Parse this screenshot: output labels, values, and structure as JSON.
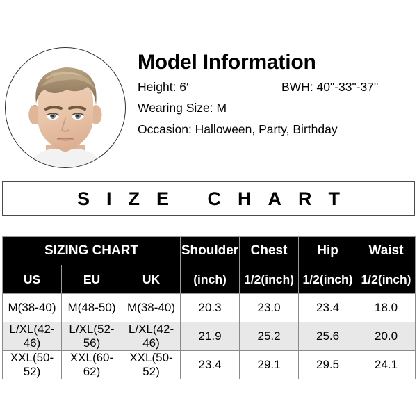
{
  "model": {
    "title": "Model Information",
    "avatar_alt": "model-portrait",
    "height_label": "Height: 6′",
    "bwh_label": "BWH: 40\"-33\"-37\"",
    "wearing_size_label": "Wearing Size: M",
    "occasion_label": "Occasion: Halloween, Party, Birthday"
  },
  "banner": {
    "text": "SIZE CHART"
  },
  "table": {
    "header_row_1": [
      {
        "label": "SIZING CHART",
        "colspan": 3
      },
      {
        "label": "Shoulder",
        "colspan": 1
      },
      {
        "label": "Chest",
        "colspan": 1
      },
      {
        "label": "Hip",
        "colspan": 1
      },
      {
        "label": "Waist",
        "colspan": 1
      }
    ],
    "header_row_2": [
      "US",
      "EU",
      "UK",
      "(inch)",
      "1/2(inch)",
      "1/2(inch)",
      "1/2(inch)"
    ],
    "rows": [
      {
        "cells": [
          "M(38-40)",
          "M(48-50)",
          "M(38-40)",
          "20.3",
          "23.0",
          "23.4",
          "18.0"
        ],
        "shaded": false
      },
      {
        "cells": [
          "L/XL(42-46)",
          "L/XL(52-56)",
          "L/XL(42-46)",
          "21.9",
          "25.2",
          "25.6",
          "20.0"
        ],
        "shaded": true
      },
      {
        "cells": [
          "XXL(50-52)",
          "XXL(60-62)",
          "XXL(50-52)",
          "23.4",
          "29.1",
          "29.5",
          "24.1"
        ],
        "shaded": false
      }
    ]
  },
  "colors": {
    "header_bg": "#000000",
    "header_text": "#ffffff",
    "shaded_row_bg": "#e8e8e8",
    "grid_line": "#8a8a8a",
    "banner_border": "#4a4a4a",
    "hair": "#9c8568",
    "skin": "#e8c4a8"
  }
}
